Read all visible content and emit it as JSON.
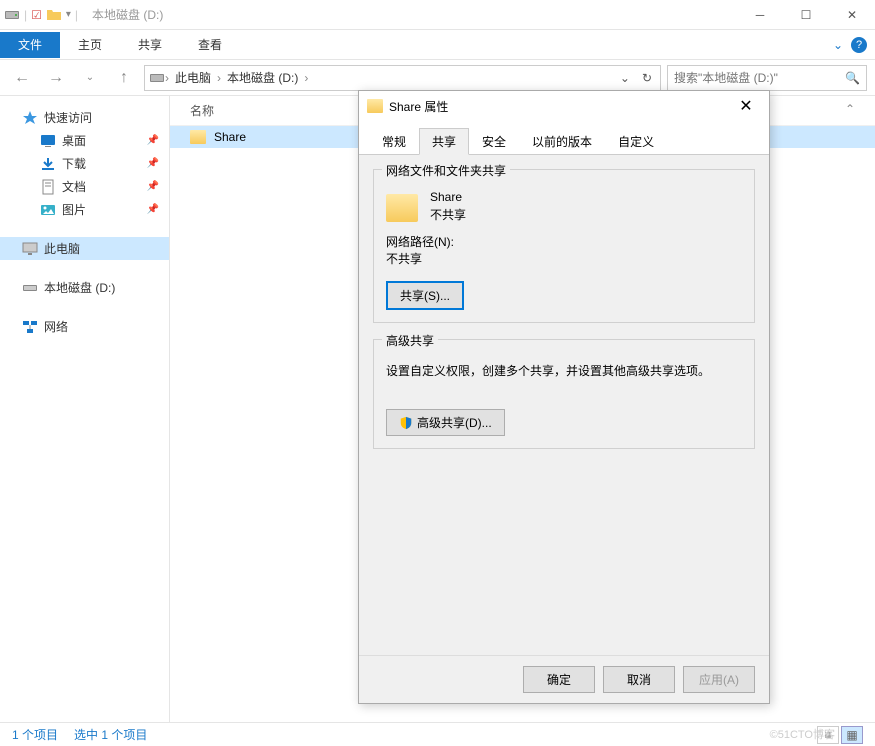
{
  "window": {
    "title": "本地磁盘 (D:)"
  },
  "ribbon": {
    "file": "文件",
    "tabs": [
      "主页",
      "共享",
      "查看"
    ]
  },
  "breadcrumb": {
    "items": [
      "此电脑",
      "本地磁盘 (D:)"
    ]
  },
  "search": {
    "placeholder": "搜索\"本地磁盘 (D:)\""
  },
  "sidebar": {
    "quick_access": "快速访问",
    "desktop": "桌面",
    "downloads": "下载",
    "documents": "文档",
    "pictures": "图片",
    "this_pc": "此电脑",
    "local_disk": "本地磁盘 (D:)",
    "network": "网络"
  },
  "content": {
    "header_name": "名称",
    "items": [
      {
        "name": "Share"
      }
    ]
  },
  "statusbar": {
    "count": "1 个项目",
    "selected": "选中 1 个项目"
  },
  "dialog": {
    "title": "Share 属性",
    "tabs": {
      "general": "常规",
      "share": "共享",
      "security": "安全",
      "previous": "以前的版本",
      "custom": "自定义"
    },
    "group1": {
      "title": "网络文件和文件夹共享",
      "name": "Share",
      "status": "不共享",
      "path_label": "网络路径(N):",
      "path_value": "不共享",
      "share_btn": "共享(S)..."
    },
    "group2": {
      "title": "高级共享",
      "desc": "设置自定义权限，创建多个共享，并设置其他高级共享选项。",
      "adv_btn": "高级共享(D)..."
    },
    "buttons": {
      "ok": "确定",
      "cancel": "取消",
      "apply": "应用(A)"
    }
  },
  "watermark": "©51CTO博客"
}
